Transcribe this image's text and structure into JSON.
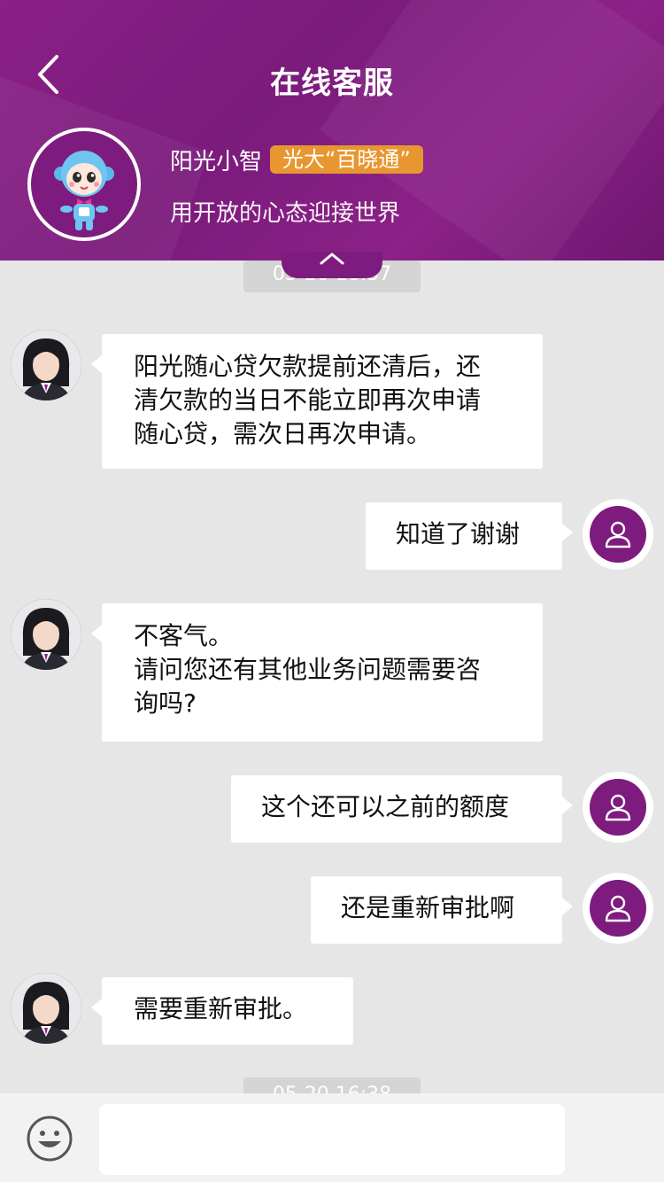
{
  "header": {
    "title": "在线客服",
    "bot_name": "阳光小智",
    "bot_badge": "光大“百晓通”",
    "bot_slogan": "用开放的心态迎接世界"
  },
  "timestamps": {
    "top": "05-20 16:37",
    "bottom": "05-20 16:38"
  },
  "messages": [
    {
      "sender": "agent",
      "lines": [
        "阳光随心贷欠款提前还清后，还",
        "清欠款的当日不能立即再次申请",
        "随心贷，需次日再次申请。"
      ]
    },
    {
      "sender": "user",
      "lines": [
        "知道了谢谢"
      ]
    },
    {
      "sender": "agent",
      "lines": [
        "不客气。",
        "请问您还有其他业务问题需要咨",
        "询吗?"
      ]
    },
    {
      "sender": "user",
      "lines": [
        "这个还可以之前的额度"
      ]
    },
    {
      "sender": "user",
      "lines": [
        "还是重新审批啊"
      ]
    },
    {
      "sender": "agent",
      "lines": [
        "需要重新审批。"
      ]
    }
  ],
  "input": {
    "placeholder": "",
    "value": ""
  },
  "colors": {
    "brand_purple": "#7d1c7e",
    "badge_orange": "#e8962f",
    "chat_bg": "#e6e6e6"
  },
  "icons": [
    "back-chevron-icon",
    "collapse-chevron-icon",
    "user-icon",
    "emoji-icon"
  ]
}
